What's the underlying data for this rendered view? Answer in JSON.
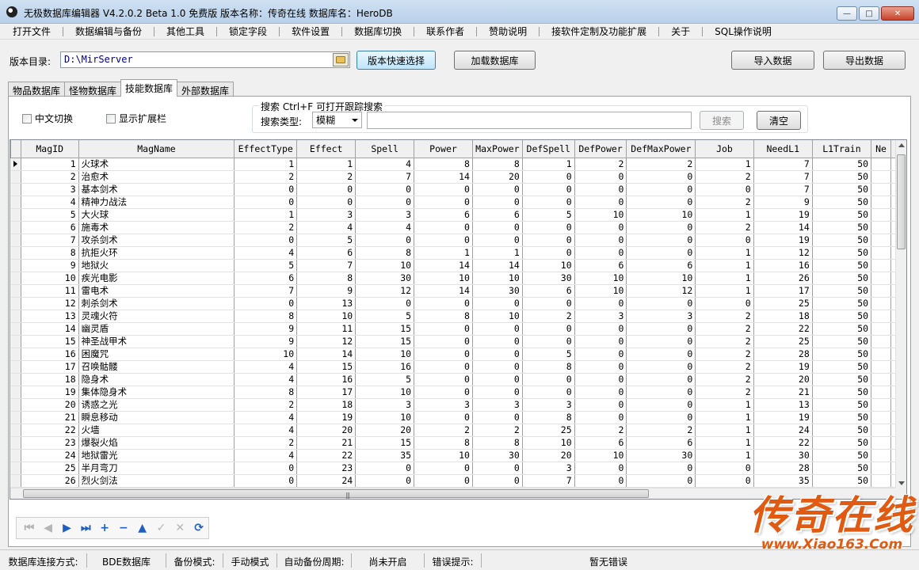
{
  "window": {
    "title": "无极数据库编辑器 V4.2.0.2    Beta 1.0 免费版    版本名称：传奇在线    数据库名：HeroDB",
    "min_glyph": "—",
    "max_glyph": "□",
    "close_glyph": "✕"
  },
  "menu": [
    "打开文件",
    "数据编辑与备份",
    "其他工具",
    "锁定字段",
    "软件设置",
    "数据库切换",
    "联系作者",
    "赞助说明",
    "接软件定制及功能扩展",
    "关于",
    "SQL操作说明"
  ],
  "toolbar": {
    "version_dir_label": "版本目录:",
    "version_dir_value": "D:\\MirServer",
    "quick_select": "版本快速选择",
    "load_db": "加载数据库",
    "import": "导入数据",
    "export": "导出数据"
  },
  "tabs": [
    "物品数据库",
    "怪物数据库",
    "技能数据库",
    "外部数据库"
  ],
  "active_tab": 2,
  "options": {
    "chinese_switch": "中文切换",
    "show_ext": "显示扩展栏"
  },
  "search": {
    "legend": "搜索  Ctrl+F 可打开跟踪搜索",
    "type_label": "搜索类型:",
    "type_value": "模糊",
    "query": "",
    "search_btn": "搜索",
    "clear_btn": "清空"
  },
  "grid": {
    "columns": [
      "MagID",
      "MagName",
      "EffectType",
      "Effect",
      "Spell",
      "Power",
      "MaxPower",
      "DefSpell",
      "DefPower",
      "DefMaxPower",
      "Job",
      "NeedL1",
      "L1Train",
      "Ne"
    ],
    "rows": [
      [
        1,
        "火球术",
        1,
        1,
        4,
        8,
        8,
        1,
        2,
        2,
        1,
        7,
        50
      ],
      [
        2,
        "治愈术",
        2,
        2,
        7,
        14,
        20,
        0,
        0,
        0,
        2,
        7,
        50
      ],
      [
        3,
        "基本剑术",
        0,
        0,
        0,
        0,
        0,
        0,
        0,
        0,
        0,
        7,
        50
      ],
      [
        4,
        "精神力战法",
        0,
        0,
        0,
        0,
        0,
        0,
        0,
        0,
        2,
        9,
        50
      ],
      [
        5,
        "大火球",
        1,
        3,
        3,
        6,
        6,
        5,
        10,
        10,
        1,
        19,
        50
      ],
      [
        6,
        "施毒术",
        2,
        4,
        4,
        0,
        0,
        0,
        0,
        0,
        2,
        14,
        50
      ],
      [
        7,
        "攻杀剑术",
        0,
        5,
        0,
        0,
        0,
        0,
        0,
        0,
        0,
        19,
        50
      ],
      [
        8,
        "抗拒火环",
        4,
        6,
        8,
        1,
        1,
        0,
        0,
        0,
        1,
        12,
        50
      ],
      [
        9,
        "地狱火",
        5,
        7,
        10,
        14,
        14,
        10,
        6,
        6,
        1,
        16,
        50
      ],
      [
        10,
        "疾光电影",
        6,
        8,
        30,
        10,
        10,
        30,
        10,
        10,
        1,
        26,
        50
      ],
      [
        11,
        "雷电术",
        7,
        9,
        12,
        14,
        30,
        6,
        10,
        12,
        1,
        17,
        50
      ],
      [
        12,
        "刺杀剑术",
        0,
        13,
        0,
        0,
        0,
        0,
        0,
        0,
        0,
        25,
        50
      ],
      [
        13,
        "灵魂火符",
        8,
        10,
        5,
        8,
        10,
        2,
        3,
        3,
        2,
        18,
        50
      ],
      [
        14,
        "幽灵盾",
        9,
        11,
        15,
        0,
        0,
        0,
        0,
        0,
        2,
        22,
        50
      ],
      [
        15,
        "神圣战甲术",
        9,
        12,
        15,
        0,
        0,
        0,
        0,
        0,
        2,
        25,
        50
      ],
      [
        16,
        "困魔咒",
        10,
        14,
        10,
        0,
        0,
        5,
        0,
        0,
        2,
        28,
        50
      ],
      [
        17,
        "召唤骷髅",
        4,
        15,
        16,
        0,
        0,
        8,
        0,
        0,
        2,
        19,
        50
      ],
      [
        18,
        "隐身术",
        4,
        16,
        5,
        0,
        0,
        0,
        0,
        0,
        2,
        20,
        50
      ],
      [
        19,
        "集体隐身术",
        8,
        17,
        10,
        0,
        0,
        0,
        0,
        0,
        2,
        21,
        50
      ],
      [
        20,
        "诱惑之光",
        2,
        18,
        3,
        3,
        3,
        3,
        0,
        0,
        1,
        13,
        50
      ],
      [
        21,
        "瞬息移动",
        4,
        19,
        10,
        0,
        0,
        8,
        0,
        0,
        1,
        19,
        50
      ],
      [
        22,
        "火墙",
        4,
        20,
        20,
        2,
        2,
        25,
        2,
        2,
        1,
        24,
        50
      ],
      [
        23,
        "爆裂火焰",
        2,
        21,
        15,
        8,
        8,
        10,
        6,
        6,
        1,
        22,
        50
      ],
      [
        24,
        "地狱雷光",
        4,
        22,
        35,
        10,
        30,
        20,
        10,
        30,
        1,
        30,
        50
      ],
      [
        25,
        "半月弯刀",
        0,
        23,
        0,
        0,
        0,
        3,
        0,
        0,
        0,
        28,
        50
      ],
      [
        26,
        "烈火剑法",
        0,
        24,
        0,
        0,
        0,
        7,
        0,
        0,
        0,
        35,
        50
      ]
    ]
  },
  "navigator": {
    "buttons": [
      {
        "name": "first-record-icon",
        "glyph": "⏮",
        "enabled": false
      },
      {
        "name": "prior-record-icon",
        "glyph": "◀",
        "enabled": false
      },
      {
        "name": "next-record-icon",
        "glyph": "▶",
        "enabled": true
      },
      {
        "name": "last-record-icon",
        "glyph": "⏭",
        "enabled": true
      },
      {
        "name": "insert-record-icon",
        "glyph": "+",
        "enabled": true
      },
      {
        "name": "delete-record-icon",
        "glyph": "−",
        "enabled": true
      },
      {
        "name": "edit-record-icon",
        "glyph": "▲",
        "enabled": true
      },
      {
        "name": "post-record-icon",
        "glyph": "✓",
        "enabled": false
      },
      {
        "name": "cancel-record-icon",
        "glyph": "✕",
        "enabled": false
      },
      {
        "name": "refresh-icon",
        "glyph": "⟳",
        "enabled": true
      }
    ]
  },
  "watermark": {
    "text": "传奇在线",
    "url": "www.Xiao163.Com"
  },
  "status": {
    "conn_label": "数据库连接方式:",
    "conn_value": "BDE数据库",
    "backup_label": "备份模式:",
    "backup_value": "手动模式",
    "period_label": "自动备份周期:",
    "period_value": "尚未开启",
    "error_label": "错误提示:",
    "error_value": "暂无错误"
  },
  "colors": {
    "accent": "#3c7fb1",
    "watermark": "#e05a12",
    "path_text": "#000080"
  }
}
